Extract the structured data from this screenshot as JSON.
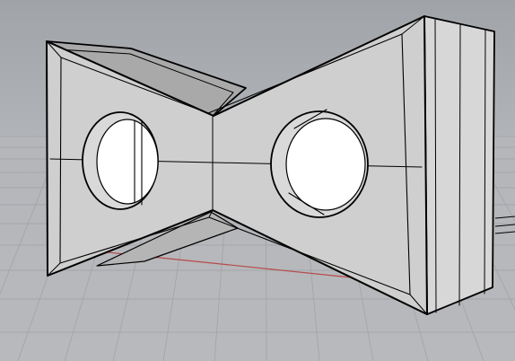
{
  "viewport": {
    "background_top": "#9fa2a7",
    "background_bottom": "#b7b8bb",
    "grid_color": "#a0a3a8",
    "axis_x_color": "#b64a4a",
    "axis_y_color": "#2ea74f",
    "model_fill": "#cfcfcf",
    "model_shadow_fill": "#b5b5b5",
    "edge_color": "#000000"
  }
}
